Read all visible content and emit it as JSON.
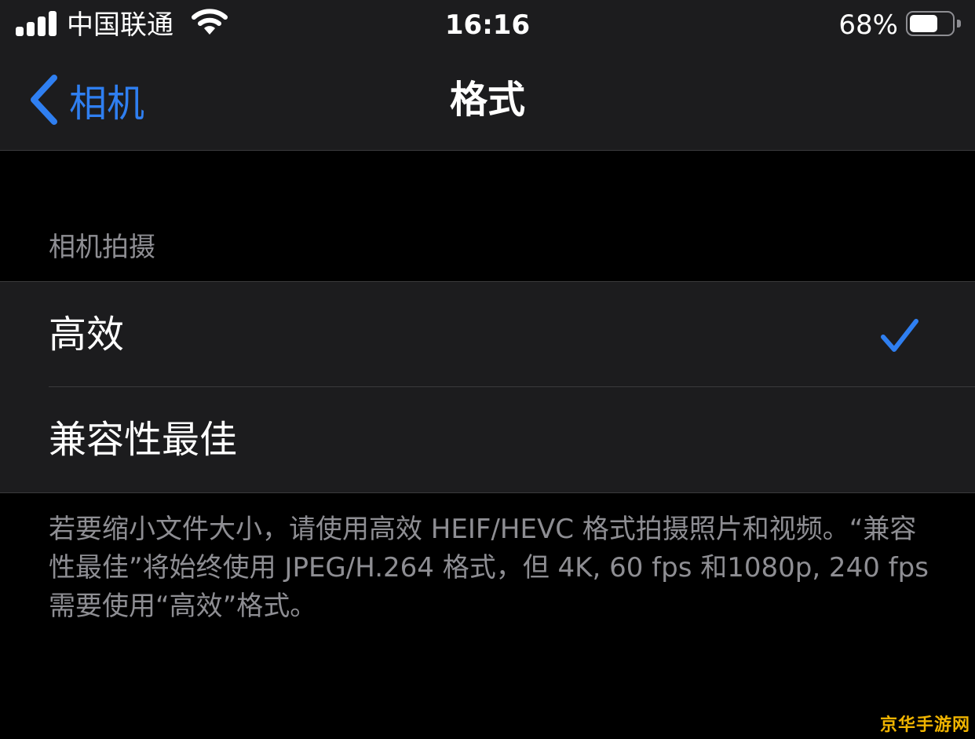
{
  "status_bar": {
    "carrier": "中国联通",
    "time": "16:16",
    "battery_percent": "68%",
    "battery_level": 0.68,
    "icons": [
      "signal-icon",
      "wifi-icon",
      "battery-icon"
    ]
  },
  "nav": {
    "back_label": "相机",
    "title": "格式"
  },
  "section": {
    "header": "相机拍摄",
    "options": [
      {
        "label": "高效",
        "selected": true
      },
      {
        "label": "兼容性最佳",
        "selected": false
      }
    ],
    "footer": "若要缩小文件大小，请使用高效 HEIF/HEVC 格式拍摄照片和视频。“兼容性最佳”将始终使用 JPEG/H.264 格式，但 4K, 60 fps 和1080p, 240 fps 需要使用“高效”格式。"
  },
  "watermark": "京华手游网",
  "colors": {
    "accent": "#2f7ff1",
    "background": "#000000",
    "grouped_background": "#1c1c1e",
    "secondary_text": "#8e8e93",
    "separator": "#3a3a3c",
    "watermark": "#f0b400"
  }
}
